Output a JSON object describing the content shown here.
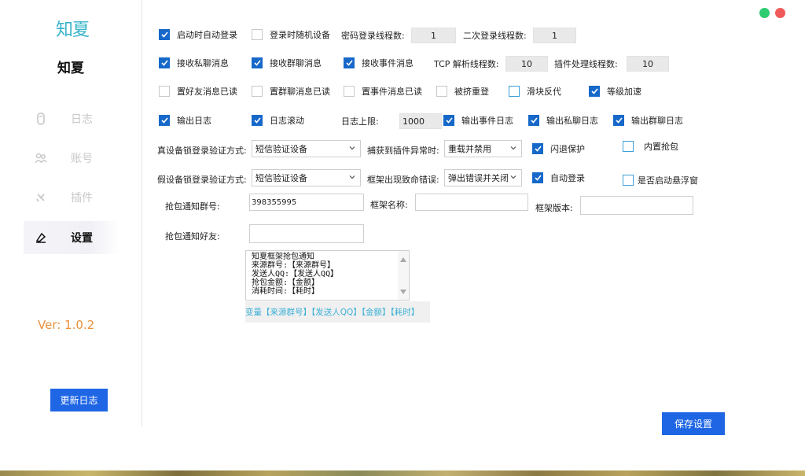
{
  "sidebar": {
    "logo_text": "知夏",
    "app_name": "知夏",
    "nav": [
      {
        "label": "日志",
        "icon": "log-icon"
      },
      {
        "label": "账号",
        "icon": "account-icon"
      },
      {
        "label": "插件",
        "icon": "plugin-icon"
      },
      {
        "label": "设置",
        "icon": "settings-icon"
      }
    ],
    "version": "Ver:  1.0.2",
    "changelog_button": "更新日志"
  },
  "window_controls": {
    "green": "#2ecc71",
    "red": "#f05a5a"
  },
  "settings": {
    "row1": {
      "auto_login": {
        "label": "启动时自动登录",
        "checked": true
      },
      "random_device": {
        "label": "登录时随机设备",
        "checked": false
      },
      "pwd_threads_label": "密码登录线程数:",
      "pwd_threads_value": "1",
      "second_threads_label": "二次登录线程数:",
      "second_threads_value": "1"
    },
    "row2": {
      "recv_private": {
        "label": "接收私聊消息",
        "checked": true
      },
      "recv_group": {
        "label": "接收群聊消息",
        "checked": true
      },
      "recv_event": {
        "label": "接收事件消息",
        "checked": true
      },
      "tcp_threads_label": "TCP 解析线程数:",
      "tcp_threads_value": "10",
      "plugin_threads_label": "插件处理线程数:",
      "plugin_threads_value": "10"
    },
    "row3": {
      "friend_read": {
        "label": "置好友消息已读",
        "checked": false
      },
      "group_read": {
        "label": "置群聊消息已读",
        "checked": false
      },
      "event_read": {
        "label": "置事件消息已读",
        "checked": false
      },
      "kick_relogin": {
        "label": "被挤重登",
        "checked": false
      },
      "slider_reverse": {
        "label": "滑块反代",
        "checked": false
      },
      "level_boost": {
        "label": "等级加速",
        "checked": true
      }
    },
    "row4": {
      "output_log": {
        "label": "输出日志",
        "checked": true
      },
      "log_scroll": {
        "label": "日志滚动",
        "checked": true
      },
      "log_limit_label": "日志上限:",
      "log_limit_value": "1000",
      "output_event_log": {
        "label": "输出事件日志",
        "checked": true
      },
      "output_private_log": {
        "label": "输出私聊日志",
        "checked": true
      },
      "output_group_log": {
        "label": "输出群聊日志",
        "checked": true
      }
    },
    "row5": {
      "real_lock_label": "真设备锁登录验证方式:",
      "real_lock_value": "短信验证设备",
      "plugin_error_label": "捕获到插件异常时:",
      "plugin_error_value": "重载并禁用",
      "crash_protect": {
        "label": "闪退保护",
        "checked": true
      },
      "builtin_grab": {
        "label": "内置抢包",
        "checked": false
      }
    },
    "row6": {
      "fake_lock_label": "假设备锁登录验证方式:",
      "fake_lock_value": "短信验证设备",
      "fatal_error_label": "框架出现致命错误:",
      "fatal_error_value": "弹出错误并关闭",
      "auto_login": {
        "label": "自动登录",
        "checked": true
      },
      "float_window": {
        "label": "是否启动悬浮窗",
        "checked": false
      }
    },
    "row7": {
      "grab_group_label": "抢包通知群号:",
      "grab_group_value": "398355995",
      "frame_name_label": "框架名称:",
      "frame_name_value": "",
      "frame_version_label": "框架版本:",
      "frame_version_value": ""
    },
    "row8": {
      "grab_friend_label": "抢包通知好友:",
      "grab_friend_value": ""
    },
    "template_text": "知夏框架抢包通知\n来源群号:【来源群号】\n发送人QQ:【发送人QQ】\n抢包金额:【金额】\n消耗时间:【耗时】",
    "variables_text": "变量【来源群号】【发送人QQ】【金额】【耗时】",
    "save_button": "保存设置"
  }
}
